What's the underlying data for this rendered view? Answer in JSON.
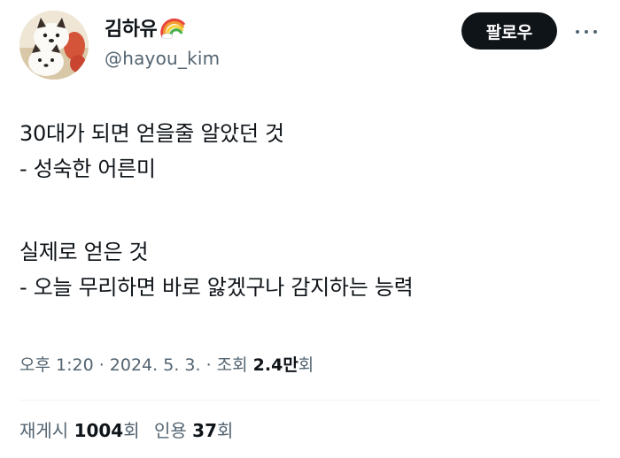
{
  "user": {
    "display_name": "김하유",
    "display_name_emoji_icon": "rainbow-icon",
    "handle": "@hayou_kim",
    "avatar_icon": "avatar-shiba-bento"
  },
  "actions": {
    "follow_label": "팔로우",
    "more_icon": "more-horizontal-icon"
  },
  "tweet": {
    "lines": [
      "30대가 되면 얻을줄 알았던 것",
      "- 성숙한 어른미",
      "",
      "실제로 얻은 것",
      "- 오늘 무리하면 바로 앓겠구나 감지하는 능력"
    ]
  },
  "meta": {
    "time": "오후 1:20",
    "sep1": " · ",
    "date": "2024. 5. 3.",
    "sep2": " · ",
    "views_label": "조회 ",
    "views_count": "2.4만",
    "views_suffix": "회"
  },
  "stats": {
    "retweets_label": "재게시 ",
    "retweets_count": "1004",
    "retweets_suffix": "회",
    "quotes_label": "인용 ",
    "quotes_count": "37",
    "quotes_suffix": "회"
  },
  "colors": {
    "text_primary": "#0f1419",
    "text_secondary": "#536471",
    "button_bg": "#0f1419",
    "divider": "#eff3f4"
  }
}
